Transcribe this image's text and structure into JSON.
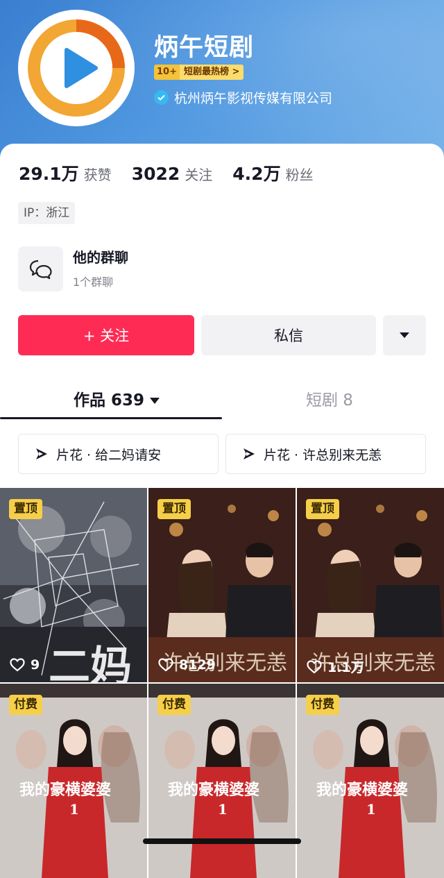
{
  "profile": {
    "name": "炳午短剧",
    "rank_number": "10+",
    "rank_text": "短剧最热榜 >",
    "verified_org": "杭州炳午影视传媒有限公司",
    "avatar_colors": {
      "ring_outer": "#f0a531",
      "ring_inner": "#e86a12",
      "play": "#2f8fe0"
    }
  },
  "stats": [
    {
      "value": "29.1万",
      "label": "获赞"
    },
    {
      "value": "3022",
      "label": "关注"
    },
    {
      "value": "4.2万",
      "label": "粉丝"
    }
  ],
  "ip_label": "IP：浙江",
  "group_chat": {
    "title": "他的群聊",
    "subtitle": "1个群聊",
    "icon": "chat-bubbles-icon"
  },
  "actions": {
    "follow": "+ 关注",
    "message": "私信",
    "more_icon": "triangle-down-icon"
  },
  "tabs": [
    {
      "label": "作品 639",
      "active": true
    },
    {
      "label": "短剧 8",
      "active": false
    }
  ],
  "clips": [
    {
      "label": "片花 · 给二妈请安",
      "icon": "play-logo-icon"
    },
    {
      "label": "片花 · 许总别来无恙",
      "icon": "play-logo-icon"
    }
  ],
  "videos": [
    {
      "tag": "置顶",
      "likes": "9",
      "poster": "cracked-glass-drama"
    },
    {
      "tag": "置顶",
      "likes": "8129",
      "poster": "couple-dinner-drama"
    },
    {
      "tag": "置顶",
      "likes": "1.1万",
      "poster": "couple-dinner-drama"
    },
    {
      "tag": "付费",
      "likes": "",
      "poster": "red-dress-drama"
    },
    {
      "tag": "付费",
      "likes": "",
      "poster": "red-dress-drama"
    },
    {
      "tag": "付费",
      "likes": "",
      "poster": "red-dress-drama"
    }
  ],
  "colors": {
    "follow": "#fe2c55",
    "header": "#3a7fd0",
    "tag": "#f6cf4a"
  }
}
